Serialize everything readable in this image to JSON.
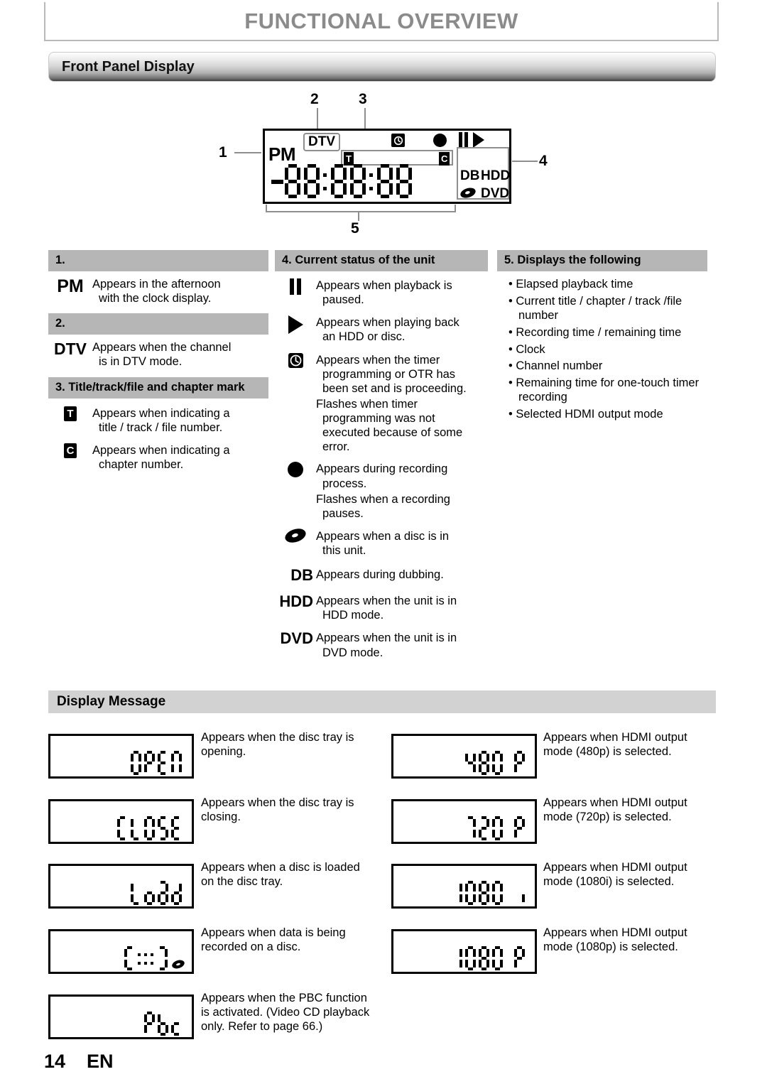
{
  "header": {
    "chapter_title": "FUNCTIONAL OVERVIEW",
    "section_title": "Front Panel Display"
  },
  "diagram": {
    "callouts": [
      "1",
      "2",
      "3",
      "4",
      "5"
    ],
    "panel": {
      "pm_label": "PM",
      "dtv_label": "DTV",
      "title_badge": "T",
      "chapter_badge": "C",
      "db_label": "DB",
      "hdd_label": "HDD",
      "dvd_label": "DVD",
      "segment_display": "-88:88:88",
      "icons": [
        "timer-icon",
        "record-icon",
        "pause-icon",
        "play-icon",
        "disc-icon"
      ]
    }
  },
  "legend": {
    "col1": {
      "groups": [
        {
          "heading": "1.",
          "entries": [
            {
              "symbol": "PM",
              "symbol_type": "text",
              "lines": [
                "Appears in the afternoon",
                "with the clock display."
              ]
            }
          ]
        },
        {
          "heading": "2.",
          "entries": [
            {
              "symbol": "DTV",
              "symbol_type": "text",
              "lines": [
                "Appears when the channel",
                "is in DTV mode."
              ]
            }
          ]
        },
        {
          "heading": "3. Title/track/file and chapter mark",
          "entries": [
            {
              "symbol": "T",
              "symbol_type": "badge",
              "lines": [
                "Appears when indicating a",
                "title / track / file number."
              ]
            },
            {
              "symbol": "C",
              "symbol_type": "badge",
              "lines": [
                "Appears when indicating a",
                "chapter number."
              ]
            }
          ]
        }
      ]
    },
    "col2": {
      "heading": "4. Current status of the unit",
      "entries": [
        {
          "symbol": "pause-icon",
          "symbol_type": "icon",
          "lines": [
            "Appears when playback is",
            "paused."
          ]
        },
        {
          "symbol": "play-icon",
          "symbol_type": "icon",
          "lines": [
            "Appears when playing back",
            "an HDD or disc."
          ]
        },
        {
          "symbol": "timer-icon",
          "symbol_type": "icon",
          "lines": [
            "Appears when the timer",
            "programming or OTR has",
            "been set and is proceeding."
          ],
          "extra": [
            "Flashes when timer",
            "programming was not",
            "executed because of some",
            "error."
          ]
        },
        {
          "symbol": "record-icon",
          "symbol_type": "icon",
          "lines": [
            "Appears during recording",
            "process."
          ],
          "extra": [
            "Flashes when a recording",
            "pauses."
          ]
        },
        {
          "symbol": "disc-icon",
          "symbol_type": "icon",
          "lines": [
            "Appears when a disc is in",
            "this unit."
          ]
        },
        {
          "symbol": "DB",
          "symbol_type": "text",
          "lines": [
            "Appears during dubbing."
          ]
        },
        {
          "symbol": "HDD",
          "symbol_type": "text",
          "lines": [
            "Appears when the unit is in",
            "HDD mode."
          ]
        },
        {
          "symbol": "DVD",
          "symbol_type": "text",
          "lines": [
            "Appears when the unit is in",
            "DVD mode."
          ]
        }
      ]
    },
    "col3": {
      "heading": "5. Displays the following",
      "items": [
        "Elapsed playback time",
        "Current title / chapter / track /file number",
        "Recording time / remaining time",
        "Clock",
        "Channel number",
        "Remaining time for one-touch timer recording",
        "Selected HDMI output mode"
      ]
    }
  },
  "display_message": {
    "heading": "Display Message",
    "left": [
      {
        "lcd": "OPEN",
        "lines": [
          "Appears when the disc tray is",
          "opening."
        ]
      },
      {
        "lcd": "CLOSE",
        "lines": [
          "Appears when the disc tray is",
          "closing."
        ]
      },
      {
        "lcd": "Load",
        "lines": [
          "Appears when a disc is loaded",
          "on the disc tray."
        ]
      },
      {
        "lcd": "[:::]",
        "lcd_extra": "disc-icon",
        "lines": [
          "Appears when data is being",
          "recorded on a disc."
        ]
      },
      {
        "lcd": "Pbc",
        "lines": [
          "Appears when the PBC function",
          "is activated. (Video CD playback",
          "only. Refer to page 66.)"
        ]
      }
    ],
    "right": [
      {
        "lcd": "480 P",
        "lines": [
          "Appears when HDMI output",
          "mode (480p) is selected."
        ]
      },
      {
        "lcd": "720 P",
        "lines": [
          "Appears when HDMI output",
          "mode (720p) is selected."
        ]
      },
      {
        "lcd": "1080 i",
        "lines": [
          "Appears when HDMI output",
          "mode (1080i) is selected."
        ]
      },
      {
        "lcd": "1080 P",
        "lines": [
          "Appears when HDMI output",
          "mode (1080p) is selected."
        ]
      }
    ]
  },
  "footer": {
    "page_number": "14",
    "language": "EN"
  },
  "colors": {
    "heading_gray": "#8b8b8b",
    "table_header_gray": "#b6b6b6",
    "dm_bar_gray": "#d2d2d2",
    "leader_gray": "#8e8e8e",
    "ink": "#000000"
  }
}
